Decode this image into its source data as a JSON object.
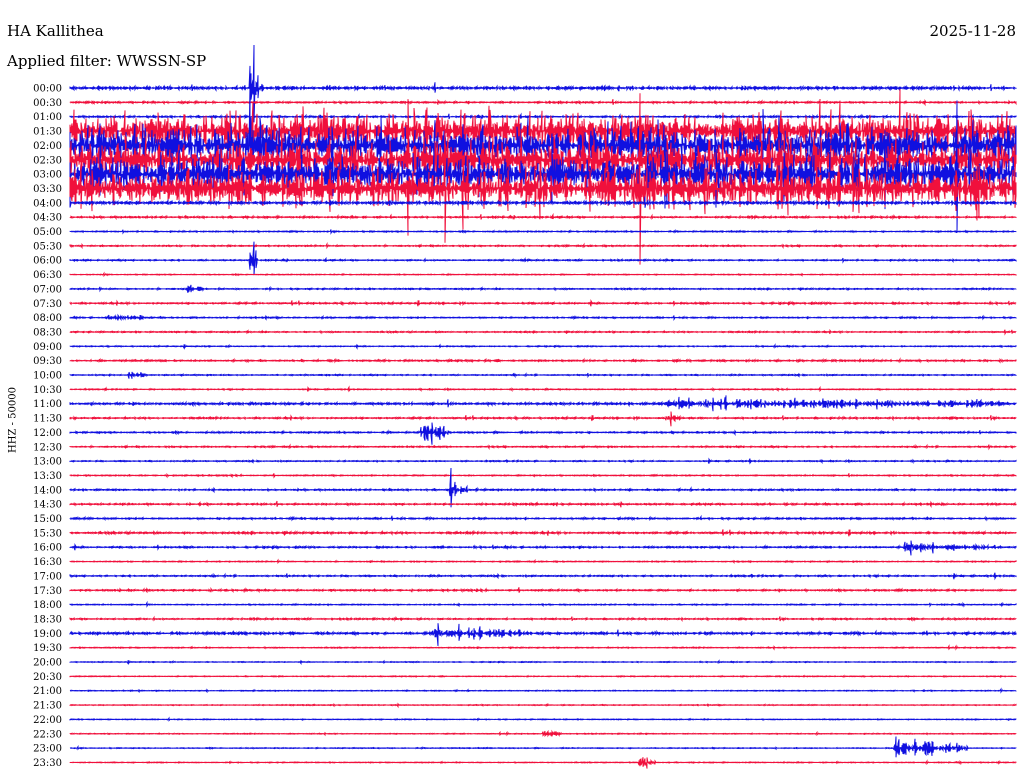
{
  "header": {
    "station": "HA Kallithea",
    "date": "2025-11-28",
    "filter": "Applied filter: WWSSN-SP"
  },
  "chart_data": {
    "type": "helicorder",
    "channel_label": "HHZ - 50000",
    "row_labels": [
      "00:00",
      "00:30",
      "01:00",
      "01:30",
      "02:00",
      "02:30",
      "03:00",
      "03:30",
      "04:00",
      "04:30",
      "05:00",
      "05:30",
      "06:00",
      "06:30",
      "07:00",
      "07:30",
      "08:00",
      "08:30",
      "09:00",
      "09:30",
      "10:00",
      "10:30",
      "11:00",
      "11:30",
      "12:00",
      "12:30",
      "13:00",
      "13:30",
      "14:00",
      "14:30",
      "15:00",
      "15:30",
      "16:00",
      "16:30",
      "17:00",
      "17:30",
      "18:00",
      "18:30",
      "19:00",
      "19:30",
      "20:00",
      "20:30",
      "21:00",
      "21:30",
      "22:00",
      "22:30",
      "23:00",
      "23:30"
    ],
    "colors": [
      "#1010e0",
      "#f0103c"
    ],
    "grid": false,
    "activity": [
      2,
      1,
      1,
      4,
      4,
      4,
      4,
      4,
      2,
      1,
      0.7,
      0.8,
      0.8,
      0.5,
      0.8,
      1,
      0.8,
      0.8,
      0.6,
      1,
      0.7,
      0.6,
      1.4,
      1,
      0.9,
      0.8,
      0.7,
      0.7,
      0.9,
      1,
      1,
      1.2,
      1,
      0.6,
      0.9,
      1,
      0.6,
      0.9,
      1.4,
      0.6,
      0.5,
      0.5,
      0.5,
      0.5,
      0.5,
      0.5,
      0.5,
      0.5
    ],
    "events": [
      {
        "row": 0,
        "pos": 0.19,
        "amp": 90,
        "len": 0.01
      },
      {
        "row": 4,
        "pos": 0.19,
        "amp": 60,
        "len": 0.02
      },
      {
        "row": 12,
        "pos": 0.19,
        "amp": 40,
        "len": 0.01
      },
      {
        "row": 14,
        "pos": 0.12,
        "amp": 10,
        "len": 0.02
      },
      {
        "row": 16,
        "pos": 0.04,
        "amp": 10,
        "len": 0.04
      },
      {
        "row": 20,
        "pos": 0.06,
        "amp": 10,
        "len": 0.02
      },
      {
        "row": 22,
        "pos": 0.63,
        "amp": 12,
        "len": 0.36
      },
      {
        "row": 23,
        "pos": 0.63,
        "amp": 14,
        "len": 0.02
      },
      {
        "row": 24,
        "pos": 0.37,
        "amp": 28,
        "len": 0.03
      },
      {
        "row": 28,
        "pos": 0.4,
        "amp": 40,
        "len": 0.02
      },
      {
        "row": 32,
        "pos": 0.88,
        "amp": 14,
        "len": 0.1
      },
      {
        "row": 38,
        "pos": 0.38,
        "amp": 18,
        "len": 0.1
      },
      {
        "row": 45,
        "pos": 0.5,
        "amp": 10,
        "len": 0.02
      },
      {
        "row": 46,
        "pos": 0.87,
        "amp": 30,
        "len": 0.08
      },
      {
        "row": 47,
        "pos": 0.6,
        "amp": 20,
        "len": 0.02
      }
    ]
  }
}
